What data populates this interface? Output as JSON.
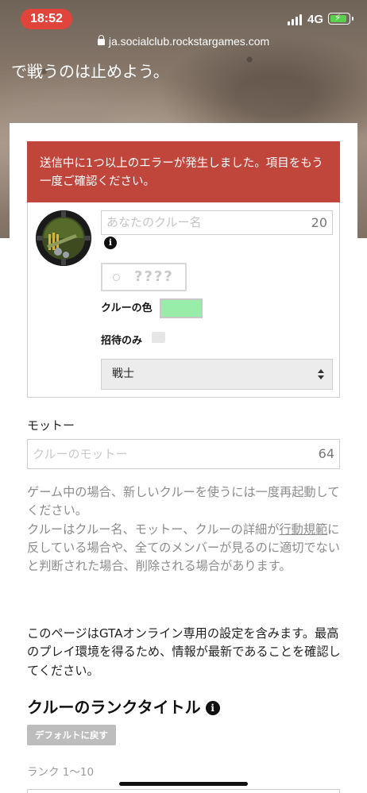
{
  "status_bar": {
    "time": "18:52",
    "network": "4G"
  },
  "browser": {
    "url": "ja.socialclub.rockstargames.com"
  },
  "hero": {
    "text": "で戦うのは止めよう。"
  },
  "error": {
    "message": "送信中に1つ以上のエラーが発生しました。項目をもう一度ご確認ください。"
  },
  "crew_form": {
    "name_placeholder": "あなたのクルー名",
    "name_counter": "20",
    "tag_placeholder": "????",
    "color_label": "クルーの色",
    "color_value": "#98eda9",
    "invite_label": "招待のみ",
    "type_select": "戦士"
  },
  "motto": {
    "label": "モットー",
    "placeholder": "クルーのモットー",
    "counter": "64"
  },
  "notes": {
    "restart": "ゲーム中の場合、新しいクルーを使うには一度再起動してください。",
    "policy_prefix": "クルーはクルー名、モットー、クルーの詳細が",
    "policy_link": "行動規範",
    "policy_suffix": "に反している場合や、全てのメンバーが見るのに適切でないと判断された場合、削除される場合があります。",
    "gta": "このページはGTAオンライン専用の設定を含みます。最高のプレイ環境を得るため、情報が最新であることを確認してください。"
  },
  "rank": {
    "heading": "クルーのランクタイトル",
    "default_button": "デフォルトに戻す",
    "range_label": "ランク 1〜10"
  },
  "colors": {
    "error_bg": "#c0453b",
    "time_pill": "#e0443a",
    "swatch": "#98eda9"
  }
}
